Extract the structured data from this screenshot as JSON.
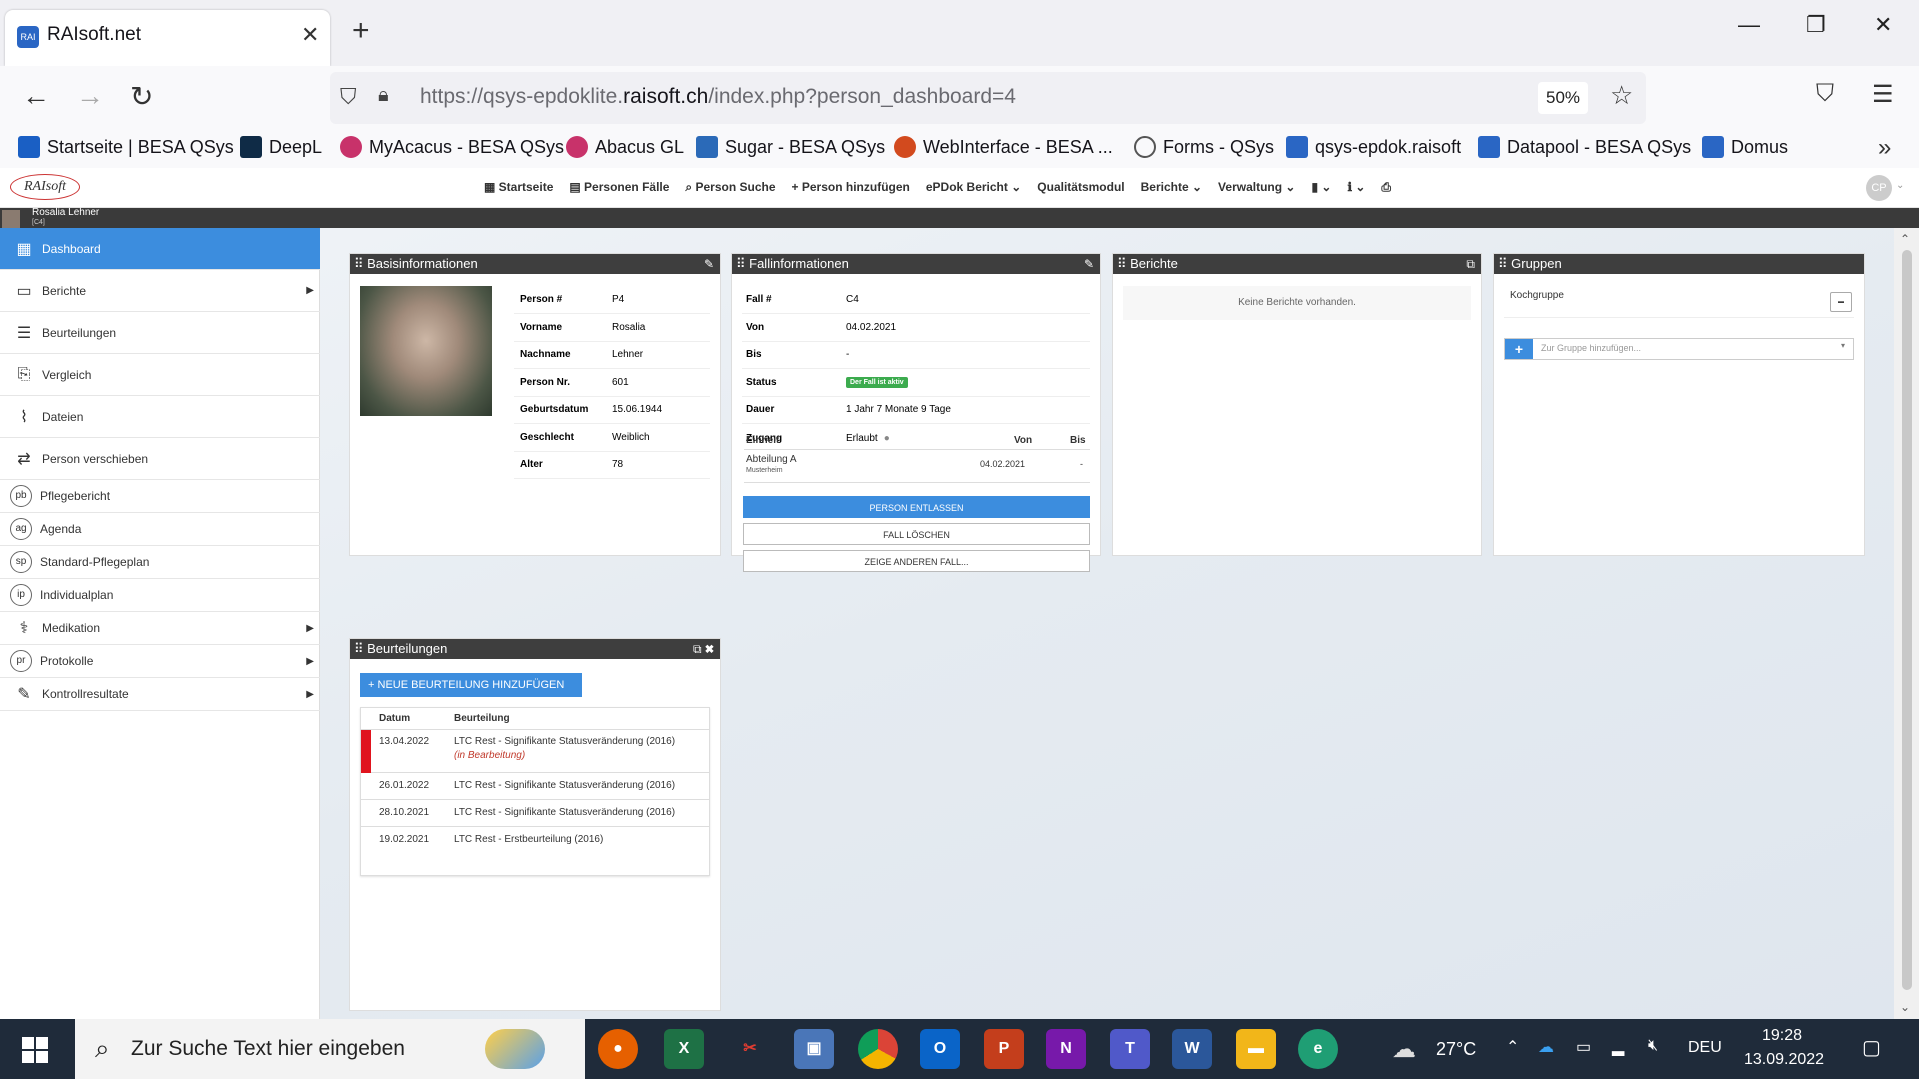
{
  "browser": {
    "tab_title": "RAIsoft.net",
    "url_prefix": "https://qsys-epdoklite.",
    "url_domain": "raisoft.ch",
    "url_path": "/index.php?person_dashboard=4",
    "zoom": "50%",
    "bookmarks": [
      {
        "label": "Startseite | BESA QSys",
        "color": "#1a5fc4"
      },
      {
        "label": "DeepL",
        "color": "#0f2b46"
      },
      {
        "label": "MyAcacus - BESA QSys",
        "color": "#c8326a"
      },
      {
        "label": "Abacus GL",
        "color": "#c8326a"
      },
      {
        "label": "Sugar - BESA QSys",
        "color": "#2b6ab8"
      },
      {
        "label": "WebInterface - BESA ...",
        "color": "#d24a1e"
      },
      {
        "label": "Forms - QSys",
        "color": "#555555"
      },
      {
        "label": "qsys-epdok.raisoft",
        "color": "#2a66c4"
      },
      {
        "label": "Datapool - BESA QSys",
        "color": "#2a66c4"
      },
      {
        "label": "Domus",
        "color": "#2a66c4"
      }
    ]
  },
  "app": {
    "logo": "RAIsoft",
    "menu": [
      "Startseite",
      "Personen Fälle",
      "Person Suche",
      "Person hinzufügen",
      "ePDok Bericht",
      "Qualitätsmodul",
      "Berichte",
      "Verwaltung"
    ],
    "user_initials": "CP",
    "person_name": "Rosalia Lehner",
    "person_case": "[C4]"
  },
  "sidebar": {
    "items": [
      {
        "label": "Dashboard",
        "icon": "grid-icon"
      },
      {
        "label": "Berichte",
        "icon": "report-icon"
      },
      {
        "label": "Beurteilungen",
        "icon": "assessment-icon"
      },
      {
        "label": "Vergleich",
        "icon": "compare-icon"
      },
      {
        "label": "Dateien",
        "icon": "paperclip-icon"
      },
      {
        "label": "Person verschieben",
        "icon": "transfer-icon"
      },
      {
        "label": "Pflegebericht",
        "badge": "pb"
      },
      {
        "label": "Agenda",
        "badge": "ag"
      },
      {
        "label": "Standard-Pflegeplan",
        "badge": "sp"
      },
      {
        "label": "Individualplan",
        "badge": "ip"
      },
      {
        "label": "Medikation",
        "icon": "pills-icon"
      },
      {
        "label": "Protokolle",
        "badge": "pr"
      },
      {
        "label": "Kontrollresultate",
        "icon": "pencil-icon"
      }
    ]
  },
  "basis": {
    "title": "Basisinformationen",
    "fields": [
      {
        "k": "Person #",
        "v": "P4"
      },
      {
        "k": "Vorname",
        "v": "Rosalia"
      },
      {
        "k": "Nachname",
        "v": "Lehner"
      },
      {
        "k": "Person Nr.",
        "v": "601"
      },
      {
        "k": "Geburtsdatum",
        "v": "15.06.1944"
      },
      {
        "k": "Geschlecht",
        "v": "Weiblich"
      },
      {
        "k": "Alter",
        "v": "78"
      }
    ]
  },
  "fall": {
    "title": "Fallinformationen",
    "fields": [
      {
        "k": "Fall #",
        "v": "C4"
      },
      {
        "k": "Von",
        "v": "04.02.2021"
      },
      {
        "k": "Bis",
        "v": "-"
      },
      {
        "k": "Status",
        "v": "Der Fall ist aktiv"
      },
      {
        "k": "Dauer",
        "v": "1 Jahr 7 Monate 9 Tage"
      },
      {
        "k": "Zugang",
        "v": "Erlaubt"
      }
    ],
    "unit_headers": [
      "Einheit",
      "Von",
      "Bis"
    ],
    "unit_name": "Abteilung A",
    "unit_sub": "Musterheim",
    "unit_from": "04.02.2021",
    "unit_to": "-",
    "btn_discharge": "PERSON ENTLASSEN",
    "btn_delete": "FALL LÖSCHEN",
    "btn_other": "ZEIGE ANDEREN FALL..."
  },
  "berichte": {
    "title": "Berichte",
    "empty": "Keine Berichte vorhanden."
  },
  "gruppen": {
    "title": "Gruppen",
    "group": "Kochgruppe",
    "placeholder": "Zur Gruppe hinzufügen..."
  },
  "beurteilungen": {
    "title": "Beurteilungen",
    "add_btn": "NEUE BEURTEILUNG HINZUFÜGEN",
    "headers": [
      "Datum",
      "Beurteilung"
    ],
    "rows": [
      {
        "date": "13.04.2022",
        "text": "LTC Rest - Signifikante Statusveränderung (2016)",
        "note": "(in Bearbeitung)"
      },
      {
        "date": "26.01.2022",
        "text": "LTC Rest - Signifikante Statusveränderung (2016)",
        "note": ""
      },
      {
        "date": "28.10.2021",
        "text": "LTC Rest - Signifikante Statusveränderung (2016)",
        "note": ""
      },
      {
        "date": "19.02.2021",
        "text": "LTC Rest - Erstbeurteilung (2016)",
        "note": ""
      }
    ]
  },
  "taskbar": {
    "search_placeholder": "Zur Suche Text hier eingeben",
    "weather": "27°C",
    "lang": "DEU",
    "time": "19:28",
    "date": "13.09.2022"
  }
}
